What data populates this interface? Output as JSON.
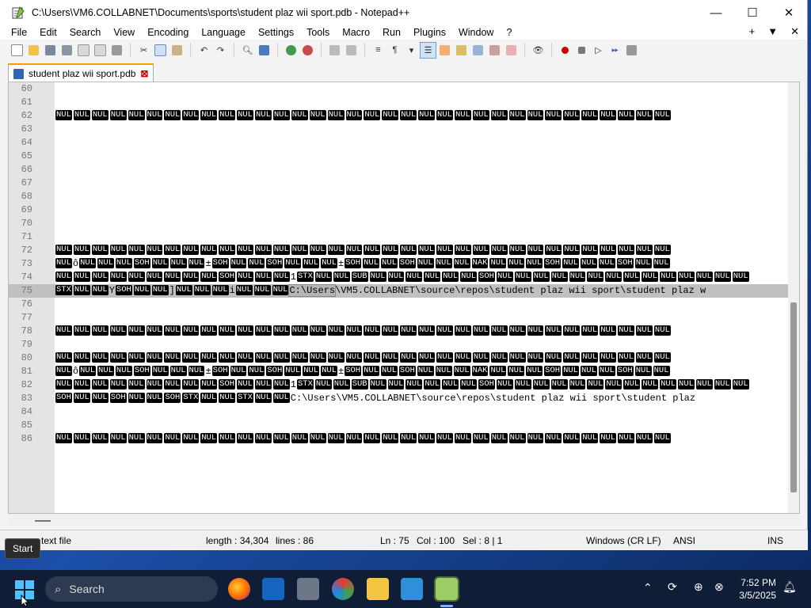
{
  "window": {
    "title": "C:\\Users\\VM6.COLLABNET\\Documents\\sports\\student plaz wii sport.pdb - Notepad++",
    "minimize": "—",
    "maximize": "☐",
    "close": "✕"
  },
  "menu": {
    "items": [
      "File",
      "Edit",
      "Search",
      "View",
      "Encoding",
      "Language",
      "Settings",
      "Tools",
      "Macro",
      "Run",
      "Plugins",
      "Window",
      "?"
    ],
    "right": [
      "+",
      "▼",
      "✕"
    ]
  },
  "tab": {
    "label": "student plaz wii sport.pdb",
    "close": "⊠"
  },
  "editor": {
    "lines": [
      {
        "n": "60",
        "t": ""
      },
      {
        "n": "61",
        "t": ""
      },
      {
        "n": "62",
        "t": "NUL×34"
      },
      {
        "n": "63",
        "t": ""
      },
      {
        "n": "64",
        "t": ""
      },
      {
        "n": "65",
        "t": ""
      },
      {
        "n": "66",
        "t": ""
      },
      {
        "n": "67",
        "t": ""
      },
      {
        "n": "68",
        "t": ""
      },
      {
        "n": "69",
        "t": ""
      },
      {
        "n": "70",
        "t": ""
      },
      {
        "n": "71",
        "t": ""
      },
      {
        "n": "72",
        "t": "NUL×34"
      },
      {
        "n": "73",
        "t": "mixed73"
      },
      {
        "n": "74",
        "t": "mixed74"
      },
      {
        "n": "75",
        "t": "mixed75"
      },
      {
        "n": "76",
        "t": ""
      },
      {
        "n": "77",
        "t": ""
      },
      {
        "n": "78",
        "t": "NUL×34"
      },
      {
        "n": "79",
        "t": ""
      },
      {
        "n": "80",
        "t": "NUL×34"
      },
      {
        "n": "81",
        "t": "mixed73"
      },
      {
        "n": "82",
        "t": "mixed74"
      },
      {
        "n": "83",
        "t": "mixed83"
      },
      {
        "n": "84",
        "t": ""
      },
      {
        "n": "85",
        "t": ""
      },
      {
        "n": "86",
        "t": "NUL×34"
      }
    ],
    "path75": "C:\\Users\\VM5.COLLABNET\\source\\repos\\student plaz wii sport\\student plaz w",
    "path83": "C:\\Users\\VM5.COLLABNET\\source\\repos\\student plaz wii sport\\student plaz"
  },
  "status": {
    "type": "text file",
    "length": "length : 34,304",
    "lines": "lines : 86",
    "ln": "Ln : 75",
    "col": "Col : 100",
    "sel": "Sel : 8 | 1",
    "eol": "Windows (CR LF)",
    "encoding": "ANSI",
    "mode": "INS"
  },
  "tooltip": {
    "start": "Start"
  },
  "taskbar": {
    "search_label": "Search",
    "time": "7:52 PM",
    "date": "3/5/2025"
  },
  "colors": {
    "tab_accent": "#f6a000",
    "control_char_bg": "#000000",
    "selection": "#b5b5b5",
    "taskbar_bg": "#0f1d36"
  }
}
